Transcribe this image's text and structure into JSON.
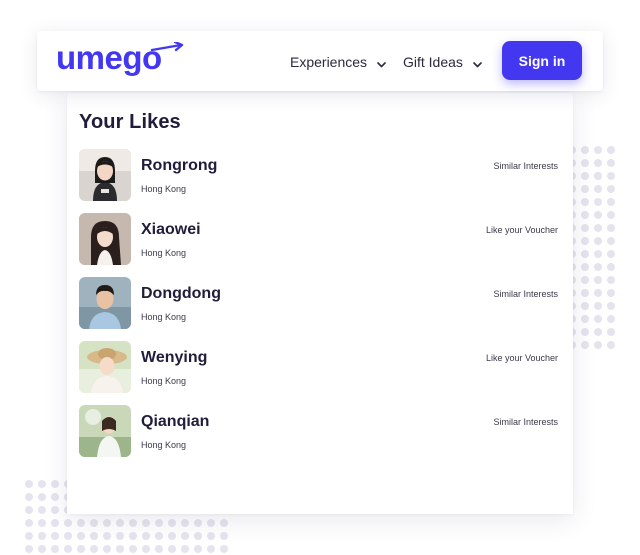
{
  "brand": {
    "name": "umego",
    "color": "#4338ef"
  },
  "nav": {
    "items": [
      {
        "label": "Experiences",
        "icon": "chevron-down-icon"
      },
      {
        "label": "Gift Ideas",
        "icon": "chevron-down-icon"
      }
    ],
    "sign_in_label": "Sign in"
  },
  "likes": {
    "title": "Your Likes",
    "items": [
      {
        "name": "Rongrong",
        "location": "Hong Kong",
        "reason": "Similar Interests"
      },
      {
        "name": "Xiaowei",
        "location": "Hong Kong",
        "reason": "Like your Voucher"
      },
      {
        "name": "Dongdong",
        "location": "Hong Kong",
        "reason": "Similar Interests"
      },
      {
        "name": "Wenying",
        "location": "Hong Kong",
        "reason": "Like your Voucher"
      },
      {
        "name": "Qianqian",
        "location": "Hong Kong",
        "reason": "Similar Interests"
      }
    ]
  },
  "colors": {
    "accent": "#4338ef",
    "text": "#1f1d3a",
    "dots": "#e5e4ee"
  }
}
